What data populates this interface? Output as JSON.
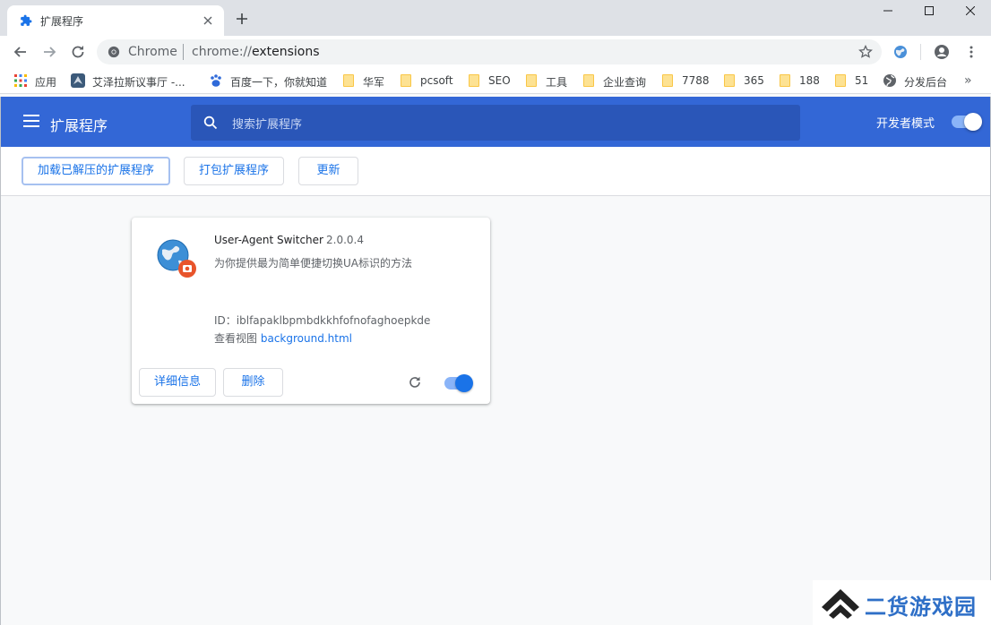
{
  "tab": {
    "title": "扩展程序",
    "icon": "puzzle-icon"
  },
  "window": {
    "minimize": "minimize-icon",
    "maximize": "maximize-icon",
    "close": "close-icon"
  },
  "omnibox": {
    "scheme_label": "Chrome",
    "url_prefix": "chrome://",
    "url_host": "extensions"
  },
  "bookmarks": [
    {
      "label": "应用",
      "icon": "apps-grid-icon"
    },
    {
      "label": "艾泽拉斯议事厅 -...",
      "icon": "site-favicon"
    },
    {
      "label": "百度一下，你就知道",
      "icon": "baidu-paw-icon"
    },
    {
      "label": "华军",
      "icon": "folder-icon"
    },
    {
      "label": "pcsoft",
      "icon": "folder-icon"
    },
    {
      "label": "SEO",
      "icon": "folder-icon"
    },
    {
      "label": "工具",
      "icon": "folder-icon"
    },
    {
      "label": "企业查询",
      "icon": "folder-icon"
    },
    {
      "label": "7788",
      "icon": "folder-icon"
    },
    {
      "label": "365",
      "icon": "folder-icon"
    },
    {
      "label": "188",
      "icon": "folder-icon"
    },
    {
      "label": "51",
      "icon": "folder-icon"
    },
    {
      "label": "分发后台",
      "icon": "globe-icon"
    }
  ],
  "header": {
    "title": "扩展程序",
    "search_placeholder": "搜索扩展程序",
    "dev_mode_label": "开发者模式",
    "dev_mode_on": true
  },
  "actions": {
    "load_unpacked": "加载已解压的扩展程序",
    "pack": "打包扩展程序",
    "update": "更新"
  },
  "extension": {
    "name": "User-Agent Switcher",
    "version": "2.0.0.4",
    "description": "为你提供最为简单便捷切换UA标识的方法",
    "id_label": "ID：",
    "id": "iblfapaklbpmbdkkhfofnofaghoepkde",
    "views_label": "查看视图",
    "views_link": "background.html",
    "details_button": "详细信息",
    "remove_button": "删除",
    "enabled": true
  },
  "watermark": {
    "text": "二货游戏园"
  },
  "colors": {
    "accent": "#1a73e8",
    "header_bg": "#3367d6",
    "tabstrip": "#dee1e6"
  }
}
